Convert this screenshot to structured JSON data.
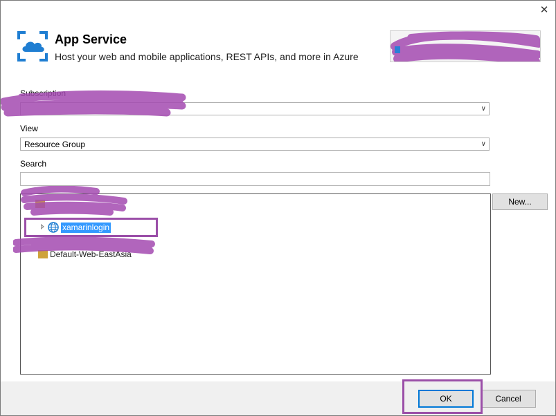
{
  "dialog": {
    "close_glyph": "✕",
    "title": "App Service",
    "subtitle": "Host your web and mobile applications, REST APIs, and more in Azure"
  },
  "form": {
    "subscription_label": "Subscription",
    "subscription_value": "",
    "view_label": "View",
    "view_value": "Resource Group",
    "search_label": "Search",
    "search_value": ""
  },
  "tree": {
    "items": [
      {
        "label": "",
        "redacted": true,
        "icon": "resource-group-icon"
      },
      {
        "label": "xamarinlogin",
        "selected": true,
        "icon": "app-service-globe-icon"
      },
      {
        "label": "Default-Web-EastAsia",
        "partially_redacted": true,
        "icon": "resource-group-icon"
      }
    ]
  },
  "buttons": {
    "new_label": "New...",
    "ok_label": "OK",
    "cancel_label": "Cancel"
  },
  "colors": {
    "azure_blue": "#1f7ed2",
    "selection": "#3399ff",
    "annotation_purple": "#9b4fa8",
    "redaction_purple": "#a34ab0",
    "footer_bg": "#f0f0f0"
  }
}
